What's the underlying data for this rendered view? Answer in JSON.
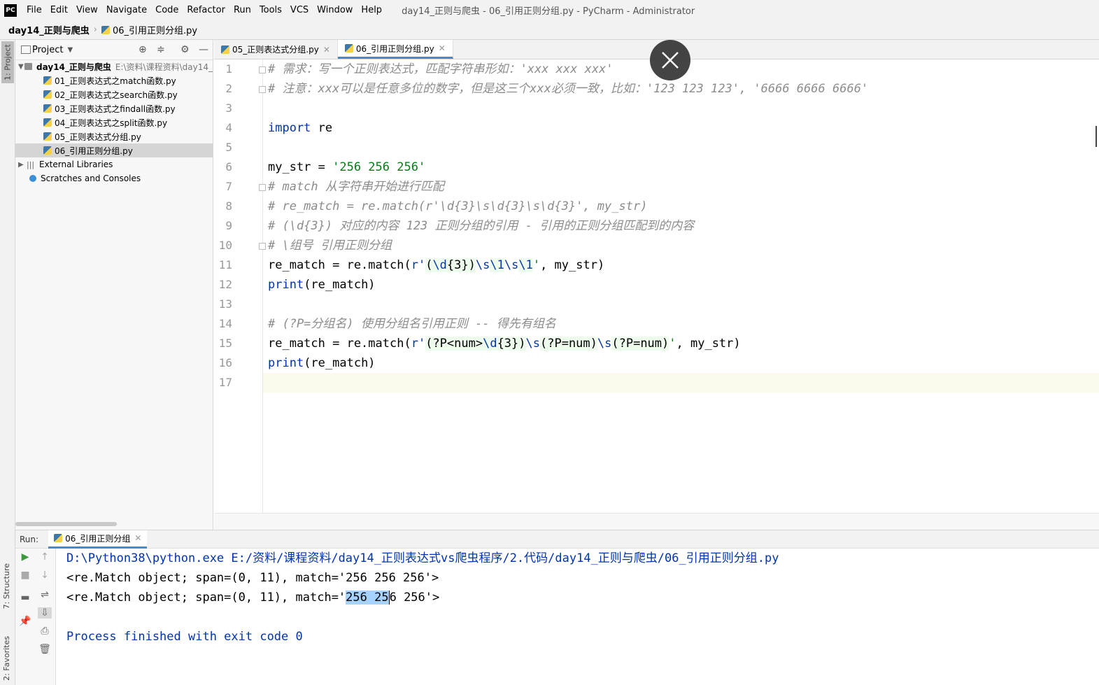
{
  "menubar": {
    "logo": "PC",
    "items": [
      "File",
      "Edit",
      "View",
      "Navigate",
      "Code",
      "Refactor",
      "Run",
      "Tools",
      "VCS",
      "Window",
      "Help"
    ],
    "window_title": "day14_正则与爬虫 - 06_引用正则分组.py - PyCharm - Administrator"
  },
  "breadcrumb": {
    "project": "day14_正则与爬虫",
    "file": "06_引用正则分组.py"
  },
  "left_stripe": {
    "project_tab": "1: Project",
    "structure_tab": "7: Structure",
    "favorites_tab": "2: Favorites"
  },
  "project_panel": {
    "title": "Project",
    "root": {
      "name": "day14_正则与爬虫",
      "path": "E:\\资料\\课程资料\\day14_"
    },
    "files": [
      "01_正则表达式之match函数.py",
      "02_正则表达式之search函数.py",
      "03_正则表达式之findall函数.py",
      "04_正则表达式之split函数.py",
      "05_正则表达式分组.py",
      "06_引用正则分组.py"
    ],
    "external_libraries": "External Libraries",
    "scratches": "Scratches and Consoles"
  },
  "editor_tabs": [
    {
      "label": "05_正则表达式分组.py",
      "active": false
    },
    {
      "label": "06_引用正则分组.py",
      "active": true
    }
  ],
  "code": {
    "line_numbers": [
      "1",
      "2",
      "3",
      "4",
      "5",
      "6",
      "7",
      "8",
      "9",
      "10",
      "11",
      "12",
      "13",
      "14",
      "15",
      "16",
      "17"
    ],
    "l1": "# 需求：写一个正则表达式，匹配字符串形如：'xxx xxx xxx'",
    "l2": "# 注意：xxx可以是任意多位的数字，但是这三个xxx必须一致，比如：'123 123 123', '6666 6666 6666'",
    "l4_kw": "import",
    "l4_rest": " re",
    "l6_lhs": "my_str = ",
    "l6_str": "'256 256 256'",
    "l7": "# match 从字符串开始进行匹配",
    "l8": "# re_match = re.match(r'\\d{3}\\s\\d{3}\\s\\d{3}', my_str)",
    "l9": "# (\\d{3}) 对应的内容 123 正则分组的引用 - 引用的正则分组匹配到的内容",
    "l10": "# \\组号 引用正则分组",
    "l11_a": "re_match = re.match(",
    "l11_b": "r'",
    "l11_c": "(",
    "l11_d": "\\d",
    "l11_e": "{3})",
    "l11_f": "\\s",
    "l11_g": "\\1",
    "l11_h": "\\s",
    "l11_i": "\\1",
    "l11_j": "'",
    "l11_k": ", my_str)",
    "l12_fn": "print",
    "l12_rest": "(re_match)",
    "l14": "# (?P=分组名) 使用分组名引用正则 -- 得先有组名",
    "l15_a": "re_match = re.match(",
    "l15_b": "r'",
    "l15_c": "(?P<num>",
    "l15_d": "\\d",
    "l15_e": "{3})",
    "l15_f": "\\s",
    "l15_g": "(?P=num)",
    "l15_h": "\\s",
    "l15_i": "(?P=num)",
    "l15_j": "'",
    "l15_k": ", my_str)",
    "l16_fn": "print",
    "l16_rest": "(re_match)"
  },
  "run_panel": {
    "label": "Run:",
    "tab": "06_引用正则分组",
    "output": {
      "cmd": "D:\\Python38\\python.exe E:/资料/课程资料/day14_正则表达式vs爬虫程序/2.代码/day14_正则与爬虫/06_引用正则分组.py",
      "line1": "<re.Match object; span=(0, 11), match='256 256 256'>",
      "line2_pre": "<re.Match object; span=(0, 11), match='",
      "line2_sel": "256 25",
      "line2_post": "6 256'>",
      "exit": "Process finished with exit code 0"
    }
  },
  "colors": {
    "keyword": "#0033b3",
    "string": "#067d17",
    "comment": "#8c8c8c",
    "selection": "#a6d2ff",
    "current_line": "#fcfaed"
  }
}
